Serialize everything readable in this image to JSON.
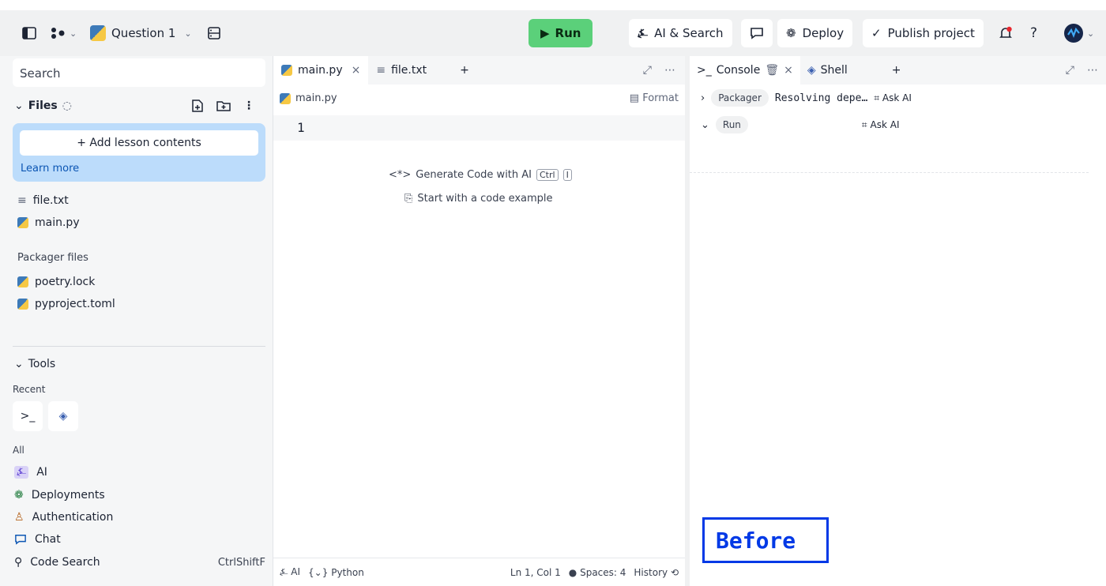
{
  "topbar": {
    "project_name": "Question 1",
    "run_label": "Run",
    "ai_search_label": "AI & Search",
    "deploy_label": "Deploy",
    "publish_label": "Publish project",
    "help_label": "?"
  },
  "sidebar": {
    "search_placeholder": "Search",
    "files_header": "Files",
    "add_lesson_label": "+ Add lesson contents",
    "learn_more": "Learn more",
    "files": [
      "file.txt",
      "main.py"
    ],
    "packager_label": "Packager files",
    "packager_files": [
      "poetry.lock",
      "pyproject.toml"
    ],
    "tools_header": "Tools",
    "recent_label": "Recent",
    "all_label": "All",
    "tools": [
      {
        "label": "AI",
        "icon": "ai-icon",
        "shortcut": ""
      },
      {
        "label": "Deployments",
        "icon": "deploy-icon",
        "shortcut": ""
      },
      {
        "label": "Authentication",
        "icon": "user-icon",
        "shortcut": ""
      },
      {
        "label": "Chat",
        "icon": "chat-icon",
        "shortcut": ""
      },
      {
        "label": "Code Search",
        "icon": "search-icon",
        "shortcut": "CtrlShiftF"
      }
    ]
  },
  "editor": {
    "tabs": [
      "main.py",
      "file.txt"
    ],
    "breadcrumb": "main.py",
    "format_label": "Format",
    "line_number": "1",
    "generate_label": "Generate Code with AI",
    "kbd_ctrl": "Ctrl",
    "kbd_i": "I",
    "example_label": "Start with a code example",
    "status": {
      "ai": "AI",
      "language": "Python",
      "position": "Ln 1, Col 1",
      "spaces": "Spaces: 4",
      "history": "History"
    }
  },
  "console": {
    "tabs": [
      "Console",
      "Shell"
    ],
    "packager_pill": "Packager",
    "packager_text": "Resolving depe…",
    "ask_ai": "Ask AI",
    "run_pill": "Run",
    "before_label": "Before"
  }
}
